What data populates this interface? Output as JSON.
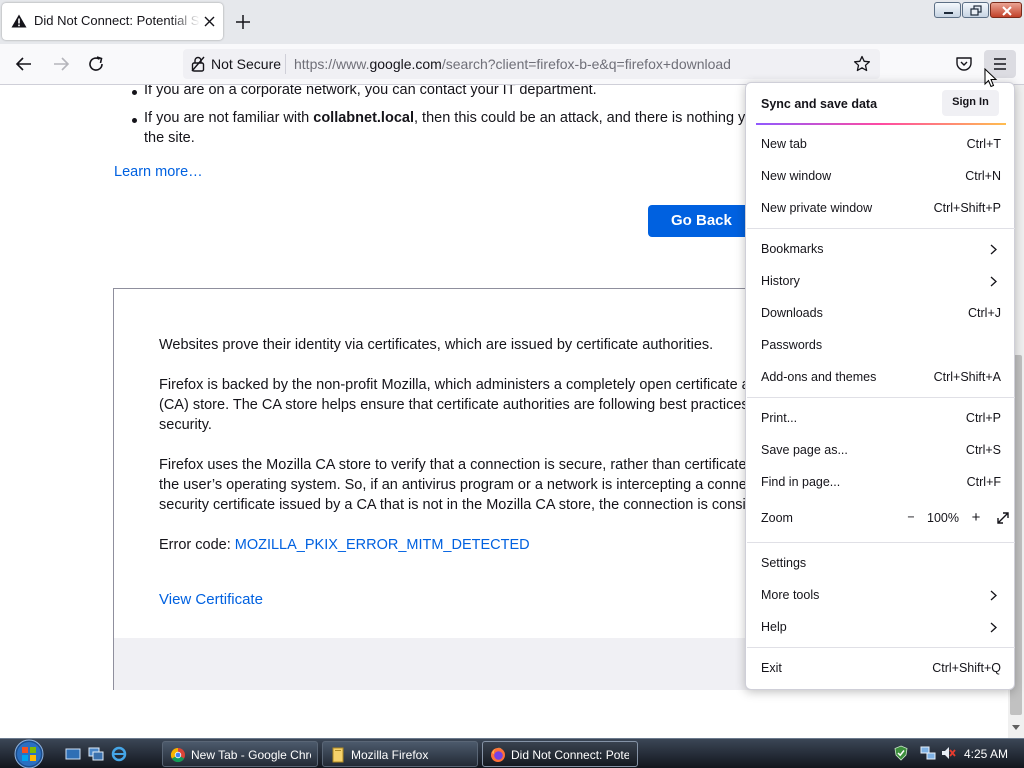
{
  "tab": {
    "title": "Did Not Connect: Potential Security Issue",
    "close_label": "Close tab",
    "new_tab_label": "Open a new tab"
  },
  "urlbar": {
    "security_label": "Not Secure",
    "url_prefix": "https://www.",
    "url_domain": "google.com",
    "url_rest": "/search?client=firefox-b-e&q=firefox+download"
  },
  "page": {
    "bullets": [
      {
        "text": "If you are on a corporate network, you can contact your IT department."
      },
      {
        "text_before": "If you are not familiar with ",
        "bold": "collabnet.local",
        "text_after": ", then this could be an attack, and there is nothing you can do to access",
        "text_line2": "the site."
      }
    ],
    "learn_more": "Learn more…",
    "go_back": "Go Back",
    "advanced": {
      "para1": "Websites prove their identity via certificates, which are issued by certificate authorities.",
      "para2_lines": [
        "Firefox is backed by the non-profit Mozilla, which administers a completely open certificate authority",
        "(CA) store. The CA store helps ensure that certificate authorities are following best practices for user",
        "security."
      ],
      "para3_lines": [
        "Firefox uses the Mozilla CA store to verify that a connection is secure, rather than certificates supplied by",
        "the user’s operating system. So, if an antivirus program or a network is intercepting a connection with a",
        "security certificate issued by a CA that is not in the Mozilla CA store, the connection is considered unsafe."
      ],
      "error_code_label": "Error code: ",
      "error_code": "MOZILLA_PKIX_ERROR_MITM_DETECTED",
      "view_certificate": "View Certificate"
    }
  },
  "menu": {
    "sync_title": "Sync and save data",
    "sign_in": "Sign In",
    "items": {
      "new_tab": {
        "label": "New tab",
        "shortcut": "Ctrl+T"
      },
      "new_window": {
        "label": "New window",
        "shortcut": "Ctrl+N"
      },
      "new_private_window": {
        "label": "New private window",
        "shortcut": "Ctrl+Shift+P"
      },
      "bookmarks": {
        "label": "Bookmarks"
      },
      "history": {
        "label": "History"
      },
      "downloads": {
        "label": "Downloads",
        "shortcut": "Ctrl+J"
      },
      "passwords": {
        "label": "Passwords"
      },
      "addons": {
        "label": "Add-ons and themes",
        "shortcut": "Ctrl+Shift+A"
      },
      "print": {
        "label": "Print...",
        "shortcut": "Ctrl+P"
      },
      "save_page": {
        "label": "Save page as...",
        "shortcut": "Ctrl+S"
      },
      "find": {
        "label": "Find in page...",
        "shortcut": "Ctrl+F"
      },
      "zoom": {
        "label": "Zoom",
        "minus": "−",
        "level": "100%",
        "plus": "+"
      },
      "settings": {
        "label": "Settings"
      },
      "more_tools": {
        "label": "More tools"
      },
      "help": {
        "label": "Help"
      },
      "exit": {
        "label": "Exit",
        "shortcut": "Ctrl+Shift+Q"
      }
    }
  },
  "taskbar": {
    "tasks": [
      {
        "label": "New Tab - Google Chrome",
        "icon": "chrome-icon"
      },
      {
        "label": "Mozilla Firefox",
        "icon": "folder-icon"
      },
      {
        "label": "Did Not Connect: Potential Security Issue",
        "icon": "firefox-icon"
      }
    ],
    "clock": "4:25 AM"
  },
  "colors": {
    "accent": "#0061e0",
    "menu_gradient": [
      "#9059ff",
      "#ff4aa2",
      "#ffbd4f"
    ]
  }
}
